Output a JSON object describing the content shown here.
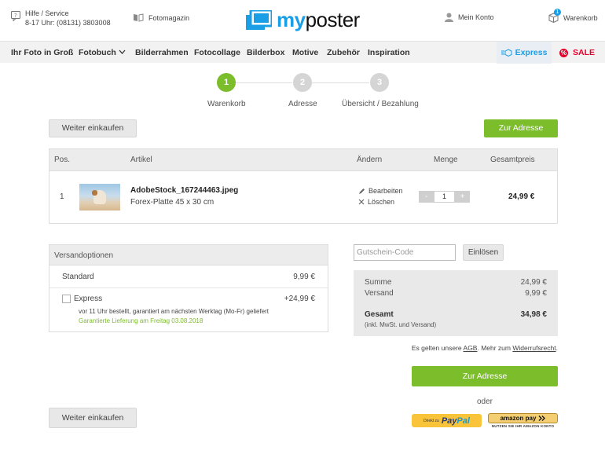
{
  "header": {
    "help_line1": "Hilfe / Service",
    "help_line2": "8-17 Uhr: (08131) 3803008",
    "magazin": "Fotomagazin",
    "logo_my": "my",
    "logo_poster": "poster",
    "account": "Mein Konto",
    "cart": "Warenkorb",
    "cart_count": "1"
  },
  "nav": {
    "items": [
      "Ihr Foto in Groß",
      "Fotobuch",
      "Bilderrahmen",
      "Fotocollage",
      "Bilderbox",
      "Motive",
      "Zubehör",
      "Inspiration"
    ],
    "express": "Express",
    "sale": "SALE"
  },
  "steps": [
    {
      "number": "1",
      "label": "Warenkorb",
      "active": true
    },
    {
      "number": "2",
      "label": "Adresse",
      "active": false
    },
    {
      "number": "3",
      "label": "Übersicht / Bezahlung",
      "active": false
    }
  ],
  "buttons": {
    "continue_shopping": "Weiter einkaufen",
    "to_address": "Zur Adresse",
    "redeem": "Einlösen"
  },
  "cart_table": {
    "headers": {
      "pos": "Pos.",
      "article": "Artikel",
      "change": "Ändern",
      "quantity": "Menge",
      "total": "Gesamtpreis"
    },
    "rows": [
      {
        "pos": "1",
        "filename": "AdobeStock_167244463.jpeg",
        "product": "Forex-Platte 45 x 30 cm",
        "edit": "Bearbeiten",
        "delete": "Löschen",
        "minus": "-",
        "qty": "1",
        "plus": "+",
        "price": "24,99 €"
      }
    ]
  },
  "shipping": {
    "title": "Versandoptionen",
    "standard_label": "Standard",
    "standard_price": "9,99 €",
    "express_label": "Express",
    "express_price": "+24,99 €",
    "express_note": "vor 11 Uhr bestellt, garantiert am nächsten Werktag (Mo-Fr) geliefert",
    "express_guarantee": "Garantierte Lieferung am Freitag 03.08.2018"
  },
  "coupon": {
    "placeholder": "Gutschein-Code"
  },
  "summary": {
    "sum_label": "Summe",
    "sum_value": "24,99 €",
    "shipping_label": "Versand",
    "shipping_value": "9,99 €",
    "total_label": "Gesamt",
    "total_value": "34,98 €",
    "total_note": "(inkl. MwSt. und Versand)"
  },
  "legal": {
    "prefix": "Es gelten unsere ",
    "agb": "AGB",
    "mid": ". Mehr zum ",
    "revocation": "Widerrufsrecht",
    "suffix": "."
  },
  "payment": {
    "oder": "oder",
    "paypal_small": "Direkt zu",
    "paypal_pay": "Pay",
    "paypal_pal": "Pal",
    "amazon_label": "amazon pay",
    "amazon_sub": "NUTZEN SIE IHR AMAZON KONTO"
  },
  "colors": {
    "green": "#7bbd2b",
    "blue": "#1a9ee6",
    "sale_red": "#e4002b"
  }
}
